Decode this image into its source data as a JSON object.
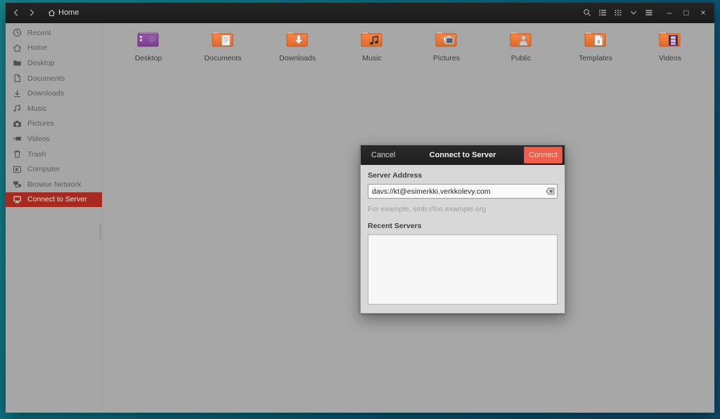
{
  "window": {
    "title": "Home",
    "nav": {
      "back": "back-arrow",
      "forward": "forward-arrow"
    },
    "buttons": {
      "search": "search-icon",
      "list_view": "list-view-icon",
      "grid_view": "grid-view-icon",
      "sort": "chevron-down-icon",
      "menu": "hamburger-menu-icon",
      "minimize": "–",
      "maximize": "□",
      "close": "×"
    }
  },
  "sidebar": {
    "items": [
      {
        "label": "Recent",
        "icon": "clock-icon",
        "selected": false
      },
      {
        "label": "Home",
        "icon": "home-icon",
        "selected": false
      },
      {
        "label": "Desktop",
        "icon": "folder-icon",
        "selected": false
      },
      {
        "label": "Documents",
        "icon": "document-icon",
        "selected": false
      },
      {
        "label": "Downloads",
        "icon": "download-icon",
        "selected": false
      },
      {
        "label": "Music",
        "icon": "music-icon",
        "selected": false
      },
      {
        "label": "Pictures",
        "icon": "camera-icon",
        "selected": false
      },
      {
        "label": "Videos",
        "icon": "video-icon",
        "selected": false
      },
      {
        "label": "Trash",
        "icon": "trash-icon",
        "selected": false
      },
      {
        "label": "Computer",
        "icon": "computer-icon",
        "selected": false
      },
      {
        "label": "Browse Network",
        "icon": "network-icon",
        "selected": false
      },
      {
        "label": "Connect to Server",
        "icon": "server-icon",
        "selected": true
      }
    ]
  },
  "files": [
    {
      "label": "Desktop",
      "icon": "folder-desktop-icon",
      "color": "#7a3f8c"
    },
    {
      "label": "Documents",
      "icon": "folder-documents-icon",
      "color": "#dd6a2a"
    },
    {
      "label": "Downloads",
      "icon": "folder-downloads-icon",
      "color": "#dd6a2a"
    },
    {
      "label": "Music",
      "icon": "folder-music-icon",
      "color": "#dd6a2a"
    },
    {
      "label": "Pictures",
      "icon": "folder-pictures-icon",
      "color": "#dd6a2a"
    },
    {
      "label": "Public",
      "icon": "folder-public-icon",
      "color": "#dd6a2a"
    },
    {
      "label": "Templates",
      "icon": "folder-templates-icon",
      "color": "#dd6a2a"
    },
    {
      "label": "Videos",
      "icon": "folder-videos-icon",
      "color": "#dd6a2a"
    }
  ],
  "dialog": {
    "title": "Connect to Server",
    "cancel_label": "Cancel",
    "connect_label": "Connect",
    "server_address_label": "Server Address",
    "server_address_value": "davs://kt@esimerkki.verkkolevy.com",
    "server_address_placeholder": "",
    "hint": "For example, smb://foo.example.org",
    "recent_servers_label": "Recent Servers",
    "recent_servers": [],
    "clear_icon": "backspace-clear-icon"
  },
  "colors": {
    "accent": "#ee5f4b",
    "selection": "#a62b1f",
    "header_bg": "#1f1f1f",
    "window_bg": "#a7a7a7",
    "dialog_bg": "#d8d8d8",
    "desktop": "#0c6a80"
  }
}
